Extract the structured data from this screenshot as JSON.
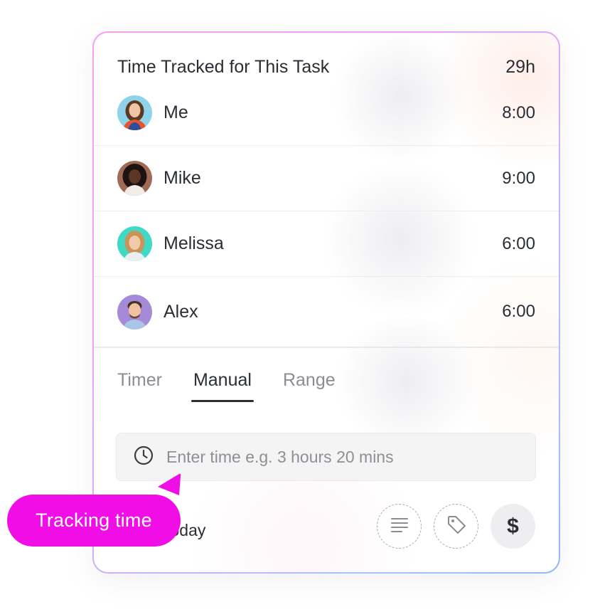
{
  "panel": {
    "title": "Time Tracked for This Task",
    "total": "29h"
  },
  "users": [
    {
      "name": "Me",
      "time": "8:00",
      "avatar_icon": "avatar-woman-blue"
    },
    {
      "name": "Mike",
      "time": "9:00",
      "avatar_icon": "avatar-woman-dark"
    },
    {
      "name": "Melissa",
      "time": "6:00",
      "avatar_icon": "avatar-woman-teal"
    },
    {
      "name": "Alex",
      "time": "6:00",
      "avatar_icon": "avatar-man-purple"
    }
  ],
  "tabs": [
    {
      "label": "Timer",
      "active": false
    },
    {
      "label": "Manual",
      "active": true
    },
    {
      "label": "Range",
      "active": false
    }
  ],
  "time_input": {
    "placeholder": "Enter time e.g. 3 hours 20 mins",
    "value": "",
    "icon": "clock-icon"
  },
  "date": {
    "label": "Today"
  },
  "actions": [
    {
      "name": "notes",
      "icon": "notes-icon"
    },
    {
      "name": "tags",
      "icon": "tag-icon"
    },
    {
      "name": "billable",
      "icon": "dollar-icon",
      "glyph": "$"
    }
  ],
  "tooltip": {
    "label": "Tracking time"
  },
  "colors": {
    "accent": "#f10ee6",
    "text": "#2a2e34",
    "muted": "#8a8d93",
    "input_bg": "#f4f4f5"
  }
}
